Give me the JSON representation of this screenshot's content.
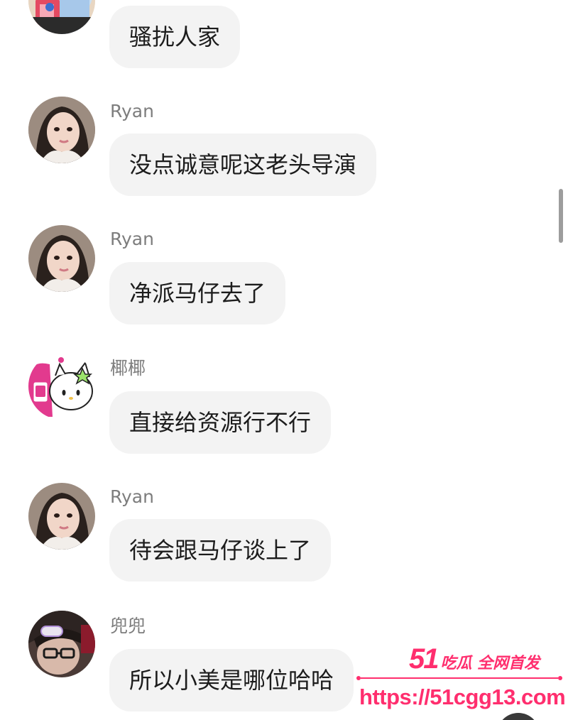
{
  "messages": [
    {
      "sender": "",
      "text": "骚扰人家",
      "avatar": "cartoon-girl-avatar"
    },
    {
      "sender": "Ryan",
      "text": "没点诚意呢这老头导演",
      "avatar": "girl-selfie-avatar"
    },
    {
      "sender": "Ryan",
      "text": "净派马仔去了",
      "avatar": "girl-selfie-avatar"
    },
    {
      "sender": "椰椰",
      "text": "直接给资源行不行",
      "avatar": "hello-kitty-avatar"
    },
    {
      "sender": "Ryan",
      "text": "待会跟马仔谈上了",
      "avatar": "girl-selfie-avatar"
    },
    {
      "sender": "兜兜",
      "text": "所以小美是哪位哈哈",
      "avatar": "boy-glasses-avatar"
    }
  ],
  "watermark": {
    "number": "51",
    "tagline": "吃瓜 全网首发",
    "url": "https://51cgg13.com",
    "color": "#ff2e6e"
  }
}
